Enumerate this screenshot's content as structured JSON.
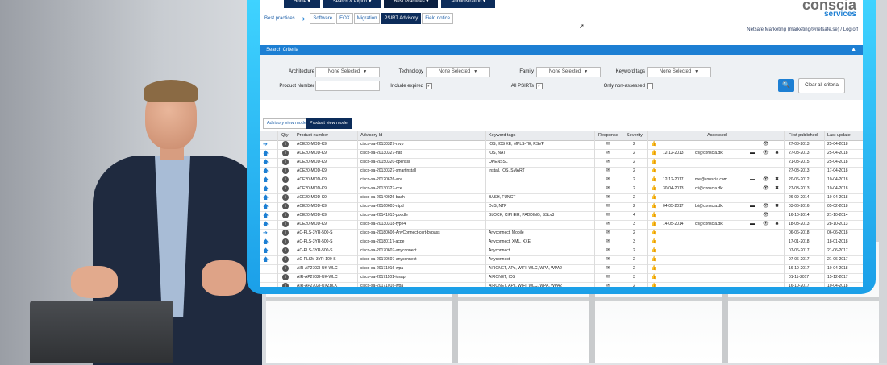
{
  "nav": {
    "tabs": [
      {
        "label": "Home ▾"
      },
      {
        "label": "Search & export ▾"
      },
      {
        "label": "Best Practices ▾"
      },
      {
        "label": "Administration ▾"
      }
    ]
  },
  "brand": {
    "name": "conscia",
    "sub": "services"
  },
  "breadcrumb": {
    "label": "Best practices",
    "tabs": [
      "Software",
      "EOX",
      "Migration",
      "PSIRT Advisory",
      "Field notice"
    ],
    "active": "PSIRT Advisory"
  },
  "user": "Netsafe Marketing (marketing@netsafe.se) / Log off",
  "criteria": {
    "title": "Search Criteria",
    "architecture_label": "Architecture",
    "architecture_value": "None Selected",
    "technology_label": "Technology",
    "technology_value": "None Selected",
    "family_label": "Family",
    "family_value": "None Selected",
    "keyword_label": "Keyword tags",
    "keyword_value": "None Selected",
    "product_number_label": "Product Number",
    "include_expired_label": "Include expired",
    "all_psirts_label": "All PSIRTs",
    "only_non_assessed_label": "Only non-assessed",
    "clear_label": "Clear all criteria"
  },
  "views": {
    "advisory": "Advisory view mode",
    "product": "Product view mode"
  },
  "table": {
    "headers": {
      "qty": "Qty",
      "product": "Product number",
      "advisory": "Advisory Id",
      "keywords": "Keyword tags",
      "response": "Response",
      "severity": "Severity",
      "assessed": "Assessed",
      "first": "First published",
      "last": "Last update"
    },
    "rows": [
      {
        "arrow": "➔",
        "product": "ACE20-MOD-K9",
        "advisory": "cisco-sa-20130327-rsvp",
        "keywords": "IOS, IOS XE, MPLS-TE, RSVP",
        "sev": "2",
        "date": "",
        "by": "",
        "first": "27-03-2013",
        "last": "25-04-2018",
        "icons": "__👁_"
      },
      {
        "arrow": "🡅",
        "product": "ACE20-MOD-K9",
        "advisory": "cisco-sa-20130327-nat",
        "keywords": "IOS, NAT",
        "sev": "2",
        "date": "12-12-2013",
        "by": "cfi@conscia.dk",
        "first": "27-03-2013",
        "last": "25-04-2018",
        "icons": "c👁✖"
      },
      {
        "arrow": "🡅",
        "product": "ACE20-MOD-K9",
        "advisory": "cisco-sa-20150320-openssl",
        "keywords": "OPENSSL",
        "sev": "2",
        "date": "",
        "by": "",
        "first": "21-03-2015",
        "last": "25-04-2018",
        "icons": ""
      },
      {
        "arrow": "🡅",
        "product": "ACE20-MOD-K9",
        "advisory": "cisco-sa-20130327-smartinstall",
        "keywords": "Install, IOS, SMART",
        "sev": "2",
        "date": "",
        "by": "",
        "first": "27-03-2013",
        "last": "17-04-2018",
        "icons": ""
      },
      {
        "arrow": "🡅",
        "product": "ACE20-MOD-K9",
        "advisory": "cisco-sa-20120626-ace",
        "keywords": "",
        "sev": "2",
        "date": "12-12-2017",
        "by": "me@conscia.com",
        "first": "20-06-2012",
        "last": "10-04-2018",
        "icons": "c👁✖"
      },
      {
        "arrow": "🡅",
        "product": "ACE20-MOD-K9",
        "advisory": "cisco-sa-20130327-cce",
        "keywords": "",
        "sev": "2",
        "date": "30-04-2013",
        "by": "cfi@conscia.dk",
        "first": "27-03-2013",
        "last": "10-04-2018",
        "icons": "_👁✖"
      },
      {
        "arrow": "🡅",
        "product": "ACE20-MOD-K9",
        "advisory": "cisco-sa-20140926-bash",
        "keywords": "BASH, FUNCT",
        "sev": "2",
        "date": "",
        "by": "",
        "first": "26-09-2014",
        "last": "10-04-2018",
        "icons": ""
      },
      {
        "arrow": "🡅",
        "product": "ACE20-MOD-K9",
        "advisory": "cisco-sa-20160603-ntpd",
        "keywords": "DoS, NTP",
        "sev": "2",
        "date": "04-05-2017",
        "by": "bli@conscia.dk",
        "first": "03-06-2016",
        "last": "05-02-2018",
        "icons": "c👁✖"
      },
      {
        "arrow": "🡅",
        "product": "ACE20-MOD-K9",
        "advisory": "cisco-sa-20141015-poodle",
        "keywords": "BLOCK, CIPHER, PADDING, SSLv3",
        "sev": "4",
        "date": "",
        "by": "",
        "first": "16-10-2014",
        "last": "21-10-2014",
        "icons": "_👁_"
      },
      {
        "arrow": "🡅",
        "product": "ACE20-MOD-K9",
        "advisory": "cisco-sa-20130318-type4",
        "keywords": "",
        "sev": "3",
        "date": "14-05-2014",
        "by": "cfi@conscia.dk",
        "first": "18-03-2013",
        "last": "28-10-2013",
        "icons": "c👁✖"
      },
      {
        "arrow": "➔",
        "product": "AC-PLS-3YR-500-S",
        "advisory": "cisco-sa-20180606-AnyConnect-cert-bypass",
        "keywords": "Anyconnect, Mobile",
        "sev": "2",
        "date": "",
        "by": "",
        "first": "06-06-2018",
        "last": "06-06-2018",
        "icons": ""
      },
      {
        "arrow": "🡅",
        "product": "AC-PLS-3YR-500-S",
        "advisory": "cisco-sa-20180117-acpe",
        "keywords": "Anyconnect, XML, XXE",
        "sev": "3",
        "date": "",
        "by": "",
        "first": "17-01-2018",
        "last": "18-01-2018",
        "icons": ""
      },
      {
        "arrow": "🡅",
        "product": "AC-PLS-3YR-500-S",
        "advisory": "cisco-sa-20170607-anyconnect",
        "keywords": "Anyconnect",
        "sev": "2",
        "date": "",
        "by": "",
        "first": "07-06-2017",
        "last": "21-06-2017",
        "icons": ""
      },
      {
        "arrow": "🡅",
        "product": "AC-PLSM-3YR-100-S",
        "advisory": "cisco-sa-20170607-anyconnect",
        "keywords": "Anyconnect",
        "sev": "2",
        "date": "",
        "by": "",
        "first": "07-06-2017",
        "last": "21-06-2017",
        "icons": ""
      },
      {
        "arrow": "",
        "product": "AIR-AP2702I-UK-WLC",
        "advisory": "cisco-sa-20171016-wpa",
        "keywords": "AIRONET, APs, WIFI, WLC, WPA, WPA2",
        "sev": "2",
        "date": "",
        "by": "",
        "first": "16-10-2017",
        "last": "10-04-2018",
        "icons": ""
      },
      {
        "arrow": "",
        "product": "AIR-AP2702I-UK-WLC",
        "advisory": "cisco-sa-20171101-iosap",
        "keywords": "AIRONET, IOS",
        "sev": "3",
        "date": "",
        "by": "",
        "first": "01-11-2017",
        "last": "15-12-2017",
        "icons": ""
      },
      {
        "arrow": "",
        "product": "AIR-AP2702I-UXZBLK",
        "advisory": "cisco-sa-20171016-wpa",
        "keywords": "AIRONET, APs, WIFI, WLC, WPA, WPA2",
        "sev": "2",
        "date": "",
        "by": "",
        "first": "16-10-2017",
        "last": "10-04-2018",
        "icons": ""
      }
    ]
  }
}
